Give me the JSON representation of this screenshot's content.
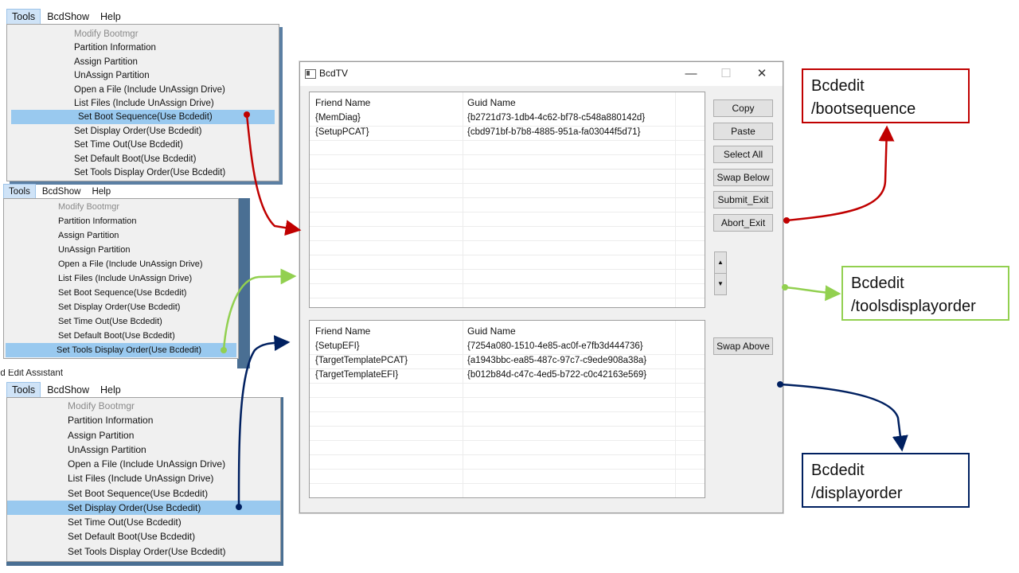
{
  "menus": {
    "menubar": [
      "Tools",
      "BcdShow",
      "Help"
    ],
    "items": [
      "Modify Bootmgr",
      "Partition Information",
      "Assign Partition",
      "UnAssign Partition",
      "Open a File (Include UnAssign Drive)",
      "List Files (Include UnAssign Drive)",
      "Set Boot Sequence(Use Bcdedit)",
      "Set Display Order(Use Bcdedit)",
      "Set Time Out(Use Bcdedit)",
      "Set Default Boot(Use Bcdedit)",
      "Set Tools Display Order(Use Bcdedit)"
    ],
    "fragment_text": "ed Edit Assistant"
  },
  "dialog": {
    "title": "BcdTV",
    "controls": {
      "minimize": "—",
      "maximize": "☐",
      "close": "✕"
    },
    "top_list": {
      "headers": [
        "Friend Name",
        "Guid Name"
      ],
      "rows": [
        [
          "{MemDiag}",
          "{b2721d73-1db4-4c62-bf78-c548a880142d}"
        ],
        [
          "{SetupPCAT}",
          "{cbd971bf-b7b8-4885-951a-fa03044f5d71}"
        ]
      ]
    },
    "bottom_list": {
      "headers": [
        "Friend Name",
        "Guid Name"
      ],
      "rows": [
        [
          "{SetupEFI}",
          "{7254a080-1510-4e85-ac0f-e7fb3d444736}"
        ],
        [
          "{TargetTemplatePCAT}",
          "{a1943bbc-ea85-487c-97c7-c9ede908a38a}"
        ],
        [
          "{TargetTemplateEFI}",
          "{b012b84d-c47c-4ed5-b722-c0c42163e569}"
        ]
      ]
    },
    "buttons": {
      "copy": "Copy",
      "paste": "Paste",
      "select_all": "Select All",
      "swap_below": "Swap Below",
      "submit_exit": "Submit_Exit",
      "abort_exit": "Abort_Exit",
      "swap_above": "Swap Above",
      "spin_up": "▲",
      "spin_down": "▼"
    }
  },
  "callouts": {
    "bootsequence": {
      "line1": "Bcdedit",
      "line2": "/bootsequence"
    },
    "toolsdisplayorder": {
      "line1": "Bcdedit",
      "line2": "/toolsdisplayorder"
    },
    "displayorder": {
      "line1": "Bcdedit",
      "line2": "/displayorder"
    }
  },
  "colors": {
    "red": "#c00000",
    "green": "#92d050",
    "navy": "#002060",
    "highlight": "#99c9ef"
  }
}
